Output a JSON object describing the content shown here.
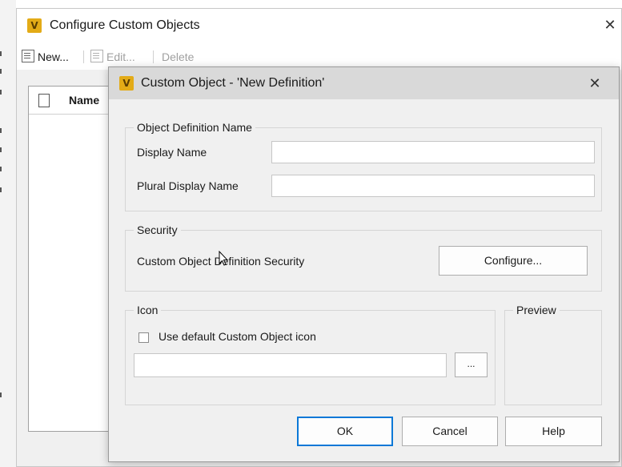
{
  "outer": {
    "title": "Configure Custom Objects",
    "close": "✕",
    "toolbar": {
      "new_label": "New...",
      "edit_label": "Edit...",
      "delete_label": "Delete"
    },
    "list": {
      "column_name": "Name"
    }
  },
  "dialog": {
    "title": "Custom Object - 'New Definition'",
    "close": "✕",
    "name_group": {
      "legend": "Object Definition Name",
      "display_name_label": "Display Name",
      "display_name_value": "",
      "plural_label": "Plural Display Name",
      "plural_value": ""
    },
    "security_group": {
      "legend": "Security",
      "label": "Custom Object Definition Security",
      "configure_label": "Configure..."
    },
    "icon_group": {
      "legend": "Icon",
      "checkbox_label": "Use default Custom Object icon",
      "checkbox_checked": false,
      "path_value": "",
      "browse_label": "..."
    },
    "preview_group": {
      "legend": "Preview"
    },
    "buttons": {
      "ok": "OK",
      "cancel": "Cancel",
      "help": "Help"
    }
  },
  "app_icon_glyph": "V",
  "colors": {
    "accent": "#0a78d7",
    "app_icon": "#e3ab17",
    "dialog_title_bar": "#d9d9d9"
  }
}
